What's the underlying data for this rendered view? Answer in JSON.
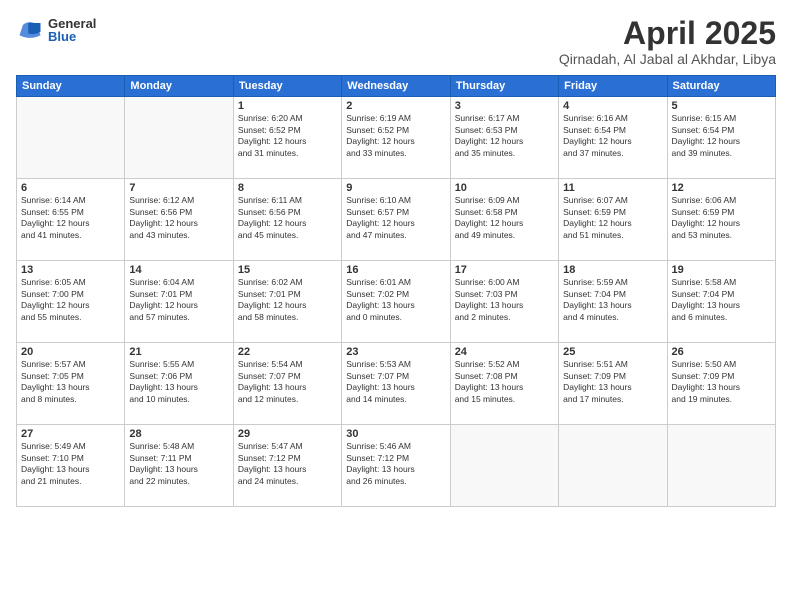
{
  "logo": {
    "general": "General",
    "blue": "Blue"
  },
  "title": "April 2025",
  "location": "Qirnadah, Al Jabal al Akhdar, Libya",
  "headers": [
    "Sunday",
    "Monday",
    "Tuesday",
    "Wednesday",
    "Thursday",
    "Friday",
    "Saturday"
  ],
  "weeks": [
    [
      {
        "day": "",
        "content": ""
      },
      {
        "day": "",
        "content": ""
      },
      {
        "day": "1",
        "content": "Sunrise: 6:20 AM\nSunset: 6:52 PM\nDaylight: 12 hours\nand 31 minutes."
      },
      {
        "day": "2",
        "content": "Sunrise: 6:19 AM\nSunset: 6:52 PM\nDaylight: 12 hours\nand 33 minutes."
      },
      {
        "day": "3",
        "content": "Sunrise: 6:17 AM\nSunset: 6:53 PM\nDaylight: 12 hours\nand 35 minutes."
      },
      {
        "day": "4",
        "content": "Sunrise: 6:16 AM\nSunset: 6:54 PM\nDaylight: 12 hours\nand 37 minutes."
      },
      {
        "day": "5",
        "content": "Sunrise: 6:15 AM\nSunset: 6:54 PM\nDaylight: 12 hours\nand 39 minutes."
      }
    ],
    [
      {
        "day": "6",
        "content": "Sunrise: 6:14 AM\nSunset: 6:55 PM\nDaylight: 12 hours\nand 41 minutes."
      },
      {
        "day": "7",
        "content": "Sunrise: 6:12 AM\nSunset: 6:56 PM\nDaylight: 12 hours\nand 43 minutes."
      },
      {
        "day": "8",
        "content": "Sunrise: 6:11 AM\nSunset: 6:56 PM\nDaylight: 12 hours\nand 45 minutes."
      },
      {
        "day": "9",
        "content": "Sunrise: 6:10 AM\nSunset: 6:57 PM\nDaylight: 12 hours\nand 47 minutes."
      },
      {
        "day": "10",
        "content": "Sunrise: 6:09 AM\nSunset: 6:58 PM\nDaylight: 12 hours\nand 49 minutes."
      },
      {
        "day": "11",
        "content": "Sunrise: 6:07 AM\nSunset: 6:59 PM\nDaylight: 12 hours\nand 51 minutes."
      },
      {
        "day": "12",
        "content": "Sunrise: 6:06 AM\nSunset: 6:59 PM\nDaylight: 12 hours\nand 53 minutes."
      }
    ],
    [
      {
        "day": "13",
        "content": "Sunrise: 6:05 AM\nSunset: 7:00 PM\nDaylight: 12 hours\nand 55 minutes."
      },
      {
        "day": "14",
        "content": "Sunrise: 6:04 AM\nSunset: 7:01 PM\nDaylight: 12 hours\nand 57 minutes."
      },
      {
        "day": "15",
        "content": "Sunrise: 6:02 AM\nSunset: 7:01 PM\nDaylight: 12 hours\nand 58 minutes."
      },
      {
        "day": "16",
        "content": "Sunrise: 6:01 AM\nSunset: 7:02 PM\nDaylight: 13 hours\nand 0 minutes."
      },
      {
        "day": "17",
        "content": "Sunrise: 6:00 AM\nSunset: 7:03 PM\nDaylight: 13 hours\nand 2 minutes."
      },
      {
        "day": "18",
        "content": "Sunrise: 5:59 AM\nSunset: 7:04 PM\nDaylight: 13 hours\nand 4 minutes."
      },
      {
        "day": "19",
        "content": "Sunrise: 5:58 AM\nSunset: 7:04 PM\nDaylight: 13 hours\nand 6 minutes."
      }
    ],
    [
      {
        "day": "20",
        "content": "Sunrise: 5:57 AM\nSunset: 7:05 PM\nDaylight: 13 hours\nand 8 minutes."
      },
      {
        "day": "21",
        "content": "Sunrise: 5:55 AM\nSunset: 7:06 PM\nDaylight: 13 hours\nand 10 minutes."
      },
      {
        "day": "22",
        "content": "Sunrise: 5:54 AM\nSunset: 7:07 PM\nDaylight: 13 hours\nand 12 minutes."
      },
      {
        "day": "23",
        "content": "Sunrise: 5:53 AM\nSunset: 7:07 PM\nDaylight: 13 hours\nand 14 minutes."
      },
      {
        "day": "24",
        "content": "Sunrise: 5:52 AM\nSunset: 7:08 PM\nDaylight: 13 hours\nand 15 minutes."
      },
      {
        "day": "25",
        "content": "Sunrise: 5:51 AM\nSunset: 7:09 PM\nDaylight: 13 hours\nand 17 minutes."
      },
      {
        "day": "26",
        "content": "Sunrise: 5:50 AM\nSunset: 7:09 PM\nDaylight: 13 hours\nand 19 minutes."
      }
    ],
    [
      {
        "day": "27",
        "content": "Sunrise: 5:49 AM\nSunset: 7:10 PM\nDaylight: 13 hours\nand 21 minutes."
      },
      {
        "day": "28",
        "content": "Sunrise: 5:48 AM\nSunset: 7:11 PM\nDaylight: 13 hours\nand 22 minutes."
      },
      {
        "day": "29",
        "content": "Sunrise: 5:47 AM\nSunset: 7:12 PM\nDaylight: 13 hours\nand 24 minutes."
      },
      {
        "day": "30",
        "content": "Sunrise: 5:46 AM\nSunset: 7:12 PM\nDaylight: 13 hours\nand 26 minutes."
      },
      {
        "day": "",
        "content": ""
      },
      {
        "day": "",
        "content": ""
      },
      {
        "day": "",
        "content": ""
      }
    ]
  ]
}
